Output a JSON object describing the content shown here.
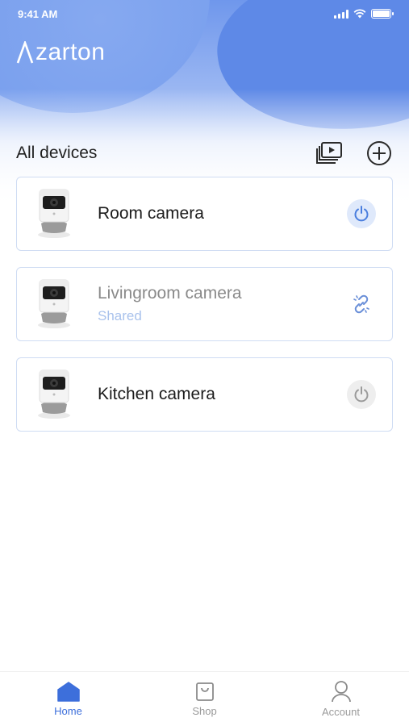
{
  "status_bar": {
    "time": "9:41 AM"
  },
  "brand": {
    "name": "zarton",
    "logo_letter": "A"
  },
  "section": {
    "title": "All devices"
  },
  "devices": [
    {
      "name": "Room camera",
      "subtitle": "",
      "state": "on",
      "action_icon": "power-icon"
    },
    {
      "name": "Livingroom camera",
      "subtitle": "Shared",
      "state": "shared",
      "action_icon": "link-icon"
    },
    {
      "name": "Kitchen camera",
      "subtitle": "",
      "state": "off",
      "action_icon": "power-icon"
    }
  ],
  "tabs": [
    {
      "label": "Home",
      "icon": "home-icon",
      "active": true
    },
    {
      "label": "Shop",
      "icon": "shopping-bag-icon",
      "active": false
    },
    {
      "label": "Account",
      "icon": "user-icon",
      "active": false
    }
  ],
  "colors": {
    "accent": "#3d6fdb",
    "card_border": "#cfdcf3",
    "shared_text": "#a9c2ec",
    "hero_blue": "#6f97ec"
  }
}
